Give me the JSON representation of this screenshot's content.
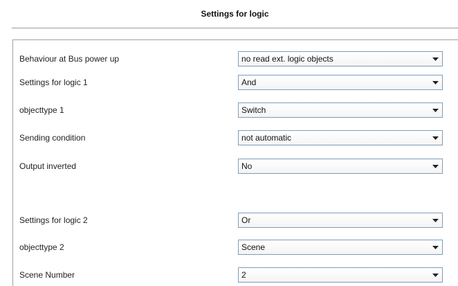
{
  "header": {
    "title": "Settings for logic"
  },
  "settings": [
    {
      "label": "Behaviour at Bus power up",
      "value": "no read ext. logic objects",
      "icon": "chevron-down-icon"
    },
    {
      "label": "Settings for logic 1",
      "value": "And",
      "icon": "chevron-down-icon"
    },
    {
      "label": "objecttype 1",
      "value": "Switch",
      "icon": "chevron-down-icon"
    },
    {
      "label": "Sending condition",
      "value": "not automatic",
      "icon": "chevron-down-icon"
    },
    {
      "label": "Output inverted",
      "value": "No",
      "icon": "chevron-down-icon"
    },
    {
      "label": "Settings for logic 2",
      "value": "Or",
      "icon": "chevron-down-icon"
    },
    {
      "label": "objecttype 2",
      "value": "Scene",
      "icon": "chevron-down-icon"
    },
    {
      "label": "Scene Number",
      "value": "2",
      "icon": "chevron-down-icon"
    }
  ],
  "colors": {
    "select_border": "#7f9db9",
    "panel_border": "#a0a0a0"
  }
}
